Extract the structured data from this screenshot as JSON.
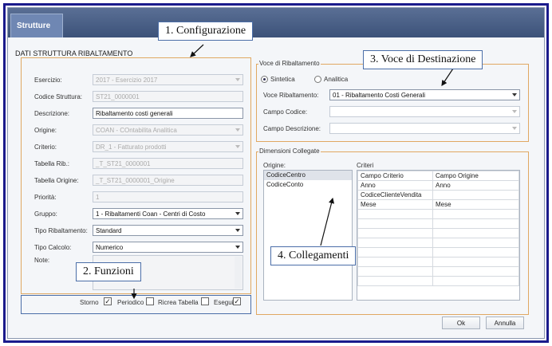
{
  "tab": "Strutture",
  "section_title": "DATI STRUTTURA RIBALTAMENTO",
  "callouts": {
    "c1": "1. Configurazione",
    "c2": "2. Funzioni",
    "c3": "3. Voce di Destinazione",
    "c4": "4. Collegamenti"
  },
  "fields": [
    {
      "label": "Esercizio:",
      "value": "2017 - Esercizio 2017",
      "state": "disabled",
      "dropdown": true
    },
    {
      "label": "Codice Struttura:",
      "value": "ST21_0000001",
      "state": "disabled",
      "dropdown": false
    },
    {
      "label": "Descrizione:",
      "value": "Ribaltamento costi generali",
      "state": "enabled",
      "dropdown": false
    },
    {
      "label": "Origine:",
      "value": "COAN - COntabilita Analitica",
      "state": "disabled",
      "dropdown": true
    },
    {
      "label": "Criterio:",
      "value": "DR_1 - Fatturato prodotti",
      "state": "disabled",
      "dropdown": true
    },
    {
      "label": "Tabella Rib.:",
      "value": "_T_ST21_0000001",
      "state": "disabled",
      "dropdown": false
    },
    {
      "label": "Tabella Origine:",
      "value": "_T_ST21_0000001_Origine",
      "state": "disabled",
      "dropdown": false
    },
    {
      "label": "Priorità:",
      "value": "1",
      "state": "disabled",
      "dropdown": false
    },
    {
      "label": "Gruppo:",
      "value": "1 - Ribaltamenti Coan - Centri di Costo",
      "state": "enabled",
      "dropdown": true
    },
    {
      "label": "Tipo Ribaltamento:",
      "value": "Standard",
      "state": "enabled",
      "dropdown": true
    },
    {
      "label": "Tipo Calcolo:",
      "value": "Numerico",
      "state": "enabled",
      "dropdown": true
    }
  ],
  "note_label": "Note:",
  "funzioni": [
    {
      "label": "Storno",
      "checked": true
    },
    {
      "label": "Periodico",
      "checked": false
    },
    {
      "label": "Ricrea Tabella",
      "checked": false
    },
    {
      "label": "Esegui",
      "checked": true
    }
  ],
  "voce": {
    "title": "Voce di Ribaltamento",
    "radio_sintetica": "Sintetica",
    "radio_analitica": "Analitica",
    "selected": "Sintetica",
    "rows": [
      {
        "label": "Voce Ribaltamento:",
        "value": "01 - Ribaltamento Costi Generali"
      },
      {
        "label": "Campo Codice:",
        "value": ""
      },
      {
        "label": "Campo Descrizione:",
        "value": ""
      }
    ]
  },
  "dimensioni": {
    "title": "Dimensioni Collegate",
    "origine_label": "Origine:",
    "criteri_label": "Criteri",
    "origine_items": [
      "CodiceCentro",
      "CodiceConto"
    ],
    "criteri_headers": [
      "Campo Criterio",
      "Campo Origine"
    ],
    "criteri_rows": [
      [
        "Anno",
        "Anno"
      ],
      [
        "CodiceClienteVendita",
        ""
      ],
      [
        "Mese",
        "Mese"
      ]
    ]
  },
  "buttons": {
    "ok": "Ok",
    "cancel": "Annulla"
  }
}
